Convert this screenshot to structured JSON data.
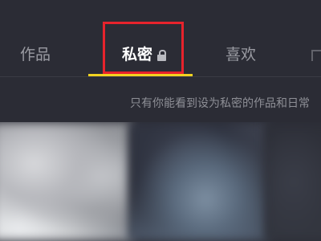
{
  "tabs": {
    "works_label": "作品",
    "private_label": "私密",
    "likes_label": "喜欢",
    "active_tab": "私密"
  },
  "notice": {
    "text": "只有你能看到设为私密的作品和日常"
  },
  "colors": {
    "background": "#2b2c35",
    "active_underline": "#f2d321",
    "highlight_box": "#e7232c",
    "inactive_tab_text": "#9a9ba2",
    "active_tab_text": "#ffffff"
  },
  "icons": {
    "private_tab_icon": "lock-icon"
  }
}
